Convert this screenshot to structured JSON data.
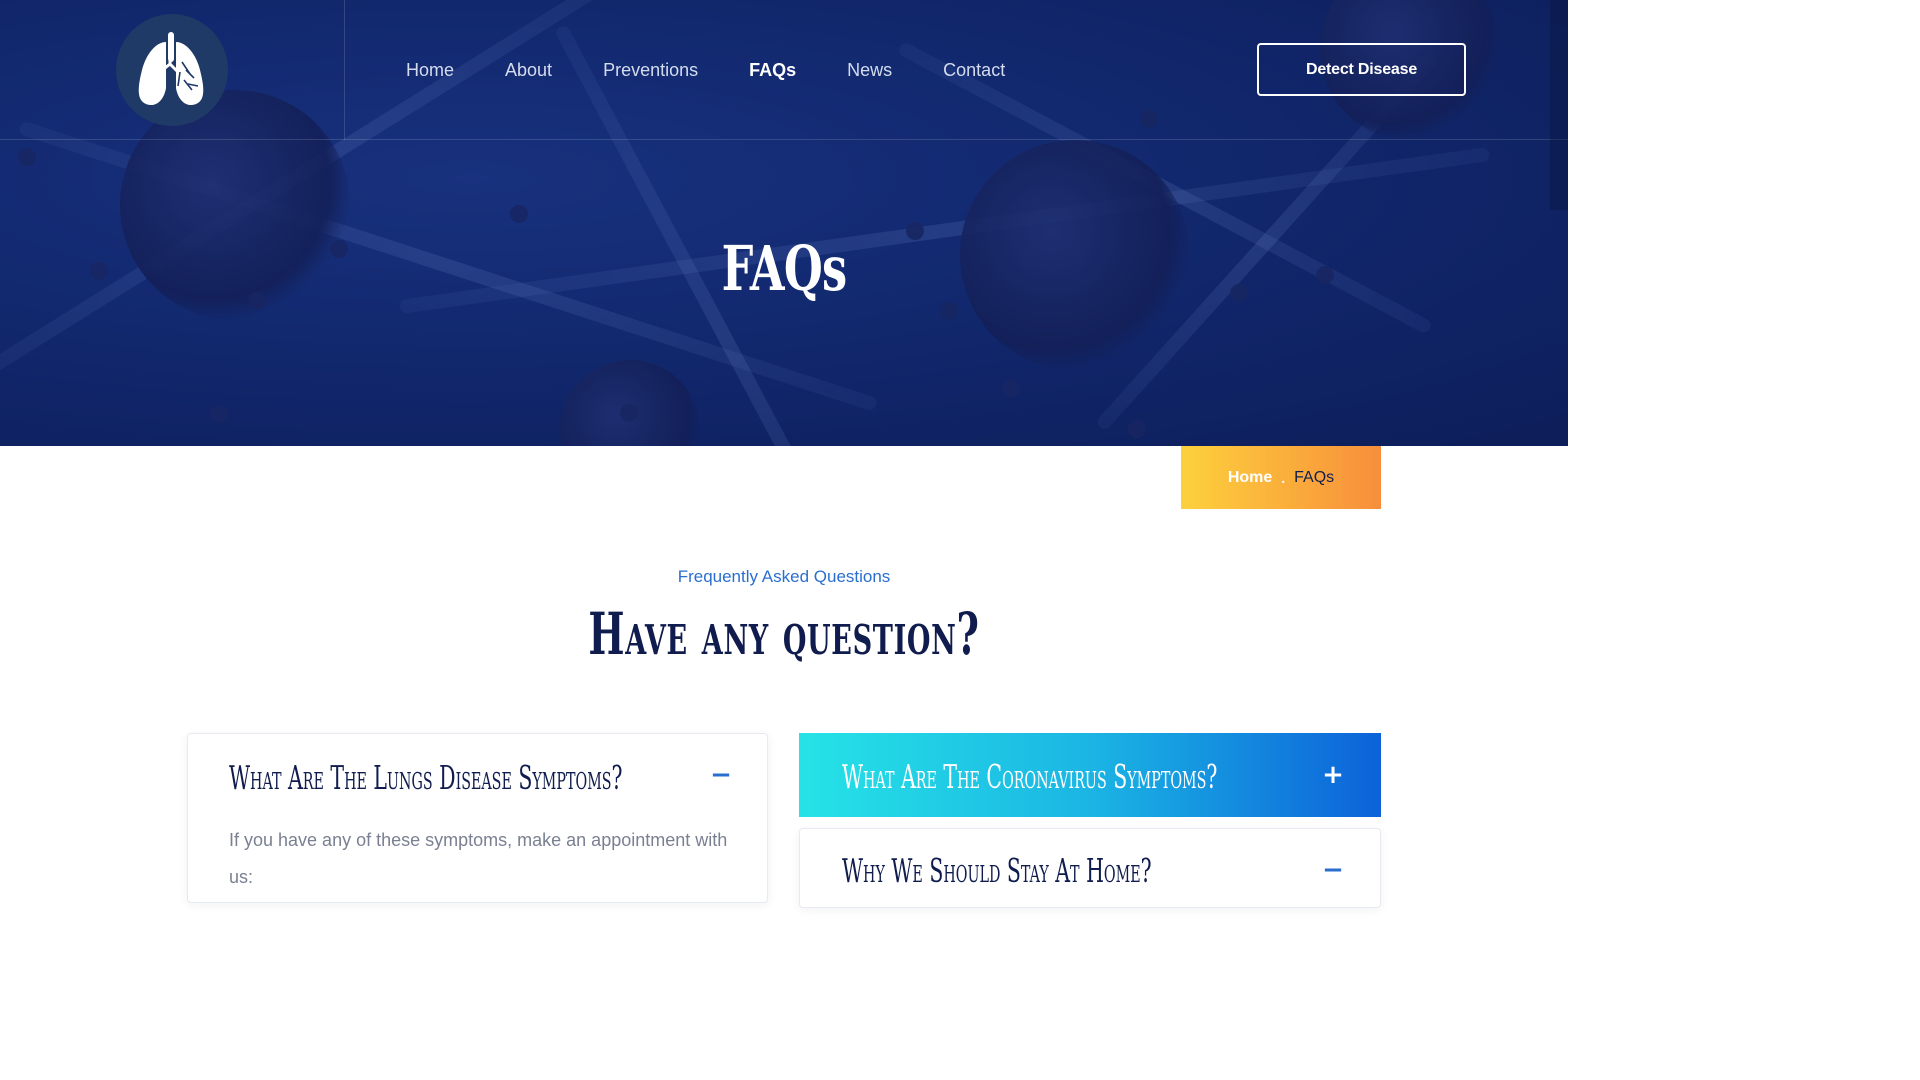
{
  "header": {
    "nav": [
      "Home",
      "About",
      "Preventions",
      "FAQs",
      "News",
      "Contact"
    ],
    "active_nav": "FAQs",
    "cta_label": "Detect Disease",
    "logo_icon": "lungs-icon"
  },
  "hero": {
    "title": "FAQs"
  },
  "breadcrumb": {
    "home": "Home",
    "separator": ".",
    "current": "FAQs"
  },
  "section": {
    "kicker": "Frequently Asked Questions",
    "title": "Have any question?"
  },
  "faq": {
    "left": [
      {
        "question": "What Are The Lungs Disease Symptoms?",
        "toggle": "−",
        "expanded": true,
        "answer": "If you have any of these symptoms, make an appointment with us:"
      }
    ],
    "right": [
      {
        "question": "What Are The Coronavirus Symptoms?",
        "toggle": "+",
        "expanded": false
      },
      {
        "question": "Why We Should Stay At Home?",
        "toggle": "−",
        "expanded": true
      }
    ]
  },
  "colors": {
    "navy": "#0f1c4d",
    "accent_blue": "#2a6fd0",
    "breadcrumb_gradient": [
      "#fcd13d",
      "#f78e3c"
    ],
    "active_card_gradient": [
      "#26e3e6",
      "#0c62d9"
    ]
  }
}
